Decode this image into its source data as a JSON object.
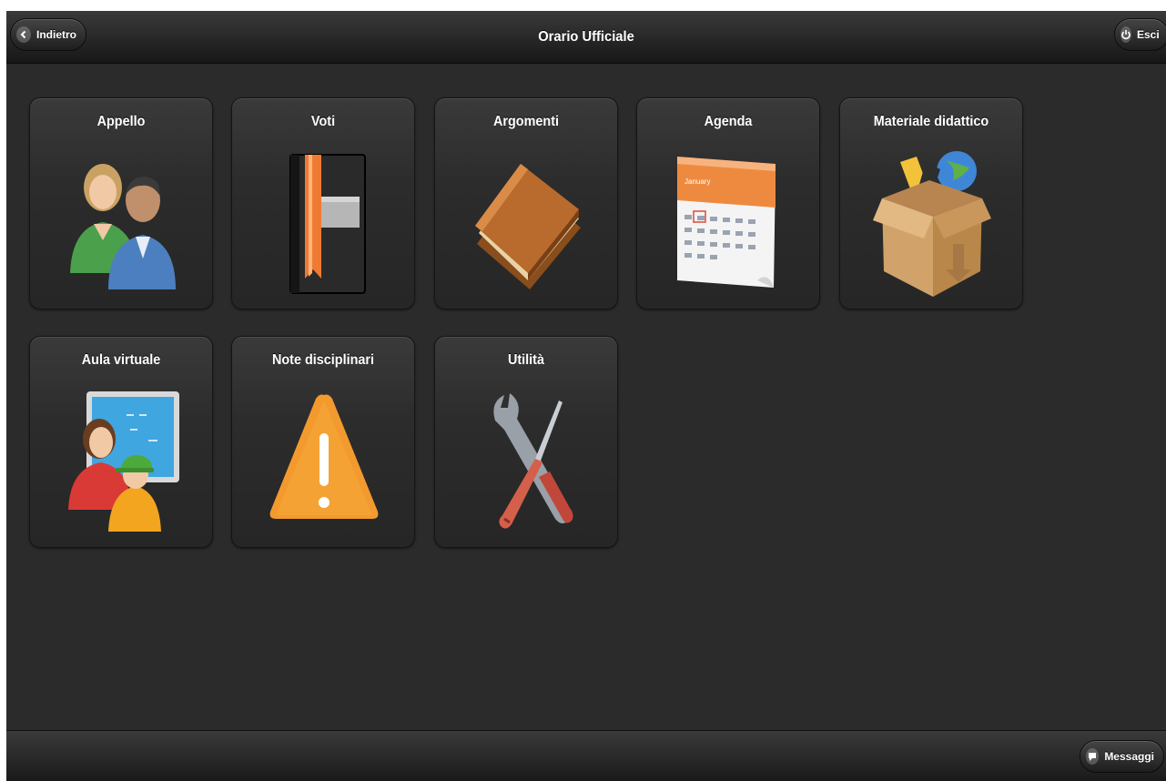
{
  "header": {
    "title": "Orario Ufficiale",
    "back_label": "Indietro",
    "exit_label": "Esci"
  },
  "tiles": [
    {
      "label": "Appello",
      "icon": "people-icon"
    },
    {
      "label": "Voti",
      "icon": "gradebook-icon"
    },
    {
      "label": "Argomenti",
      "icon": "books-icon"
    },
    {
      "label": "Agenda",
      "icon": "calendar-icon"
    },
    {
      "label": "Materiale didattico",
      "icon": "box-icon"
    },
    {
      "label": "Aula virtuale",
      "icon": "virtual-classroom-icon"
    },
    {
      "label": "Note disciplinari",
      "icon": "warning-icon"
    },
    {
      "label": "Utilità",
      "icon": "tools-icon"
    }
  ],
  "calendar_month": "January",
  "footer": {
    "messages_label": "Messaggi"
  },
  "colors": {
    "background": "#2b2b2b",
    "accent_orange": "#f08a2c"
  }
}
